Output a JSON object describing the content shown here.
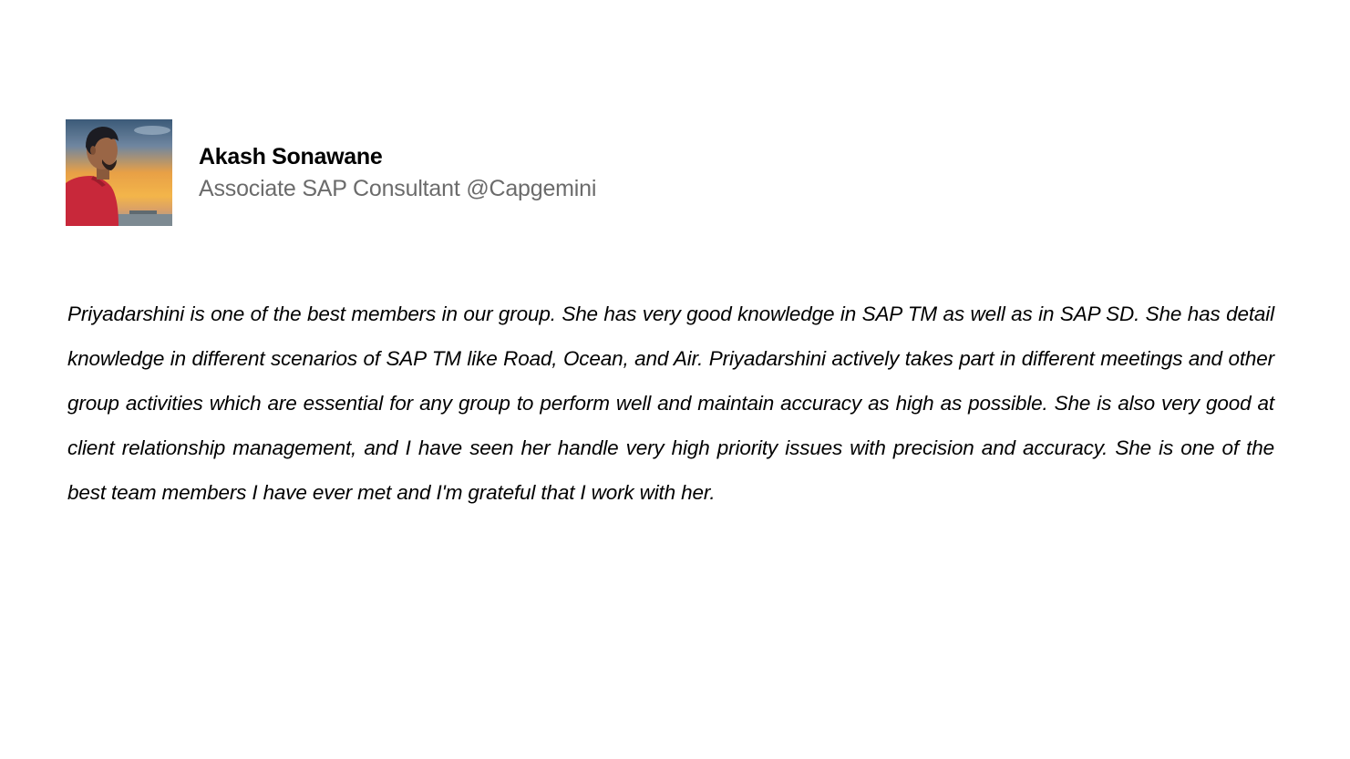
{
  "author": {
    "name": "Akash Sonawane",
    "title": "Associate SAP Consultant @Capgemini",
    "avatar": "profile-photo"
  },
  "testimonial": {
    "text": "Priyadarshini is one of the best members in our group. She has very good knowledge in SAP TM as well as in SAP SD. She has detail knowledge in different scenarios of SAP TM like Road, Ocean, and Air. Priyadarshini actively takes part in different meetings and other group activities which are essential for any group to perform well and maintain accuracy as high as possible. She is also very good at client relationship management, and I have seen her handle very high priority issues with precision and accuracy. She is one of the best team members I have ever met and I'm grateful that I work with her."
  }
}
